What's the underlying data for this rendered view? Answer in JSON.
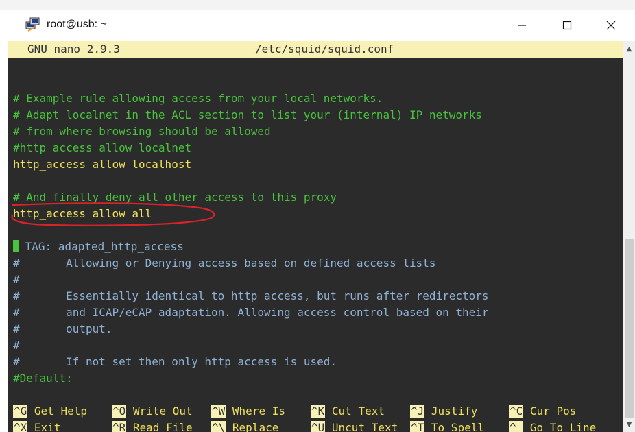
{
  "window": {
    "title": "root@usb: ~",
    "app_icon": "putty-icon",
    "controls": {
      "minimize": "minimize-icon",
      "maximize": "maximize-icon",
      "close": "close-icon"
    }
  },
  "editor": {
    "version": "GNU nano 2.9.3",
    "filename": "/etc/squid/squid.conf",
    "lines": [
      {
        "text": ""
      },
      {
        "text": ""
      },
      {
        "text": "# Example rule allowing access from your local networks.",
        "type": "comment"
      },
      {
        "text": "# Adapt localnet in the ACL section to list your (internal) IP networks",
        "type": "comment"
      },
      {
        "text": "# from where browsing should be allowed",
        "type": "comment"
      },
      {
        "text": "#http_access allow localnet",
        "type": "comment"
      },
      {
        "text": "http_access allow localhost",
        "type": "directive"
      },
      {
        "text": ""
      },
      {
        "text": "# And finally deny all other access to this proxy",
        "type": "comment"
      },
      {
        "text": "http_access allow all",
        "type": "directive"
      },
      {
        "text": ""
      },
      {
        "text": " TAG: adapted_http_access",
        "type": "tag",
        "prefix": "#"
      },
      {
        "text": "#       Allowing or Denying access based on defined access lists",
        "type": "doc"
      },
      {
        "text": "#",
        "type": "doc"
      },
      {
        "text": "#       Essentially identical to http_access, but runs after redirectors",
        "type": "doc"
      },
      {
        "text": "#       and ICAP/eCAP adaptation. Allowing access control based on their",
        "type": "doc"
      },
      {
        "text": "#       output.",
        "type": "doc"
      },
      {
        "text": "#",
        "type": "doc"
      },
      {
        "text": "#       If not set then only http_access is used.",
        "type": "doc"
      },
      {
        "text": "#Default:",
        "type": "comment"
      }
    ],
    "shortcuts_row1": [
      {
        "key": "^G",
        "label": "Get Help"
      },
      {
        "key": "^O",
        "label": "Write Out"
      },
      {
        "key": "^W",
        "label": "Where Is"
      },
      {
        "key": "^K",
        "label": "Cut Text"
      },
      {
        "key": "^J",
        "label": "Justify"
      },
      {
        "key": "^C",
        "label": "Cur Pos"
      }
    ],
    "shortcuts_row2": [
      {
        "key": "^X",
        "label": "Exit"
      },
      {
        "key": "^R",
        "label": "Read File"
      },
      {
        "key": "^\\",
        "label": "Replace"
      },
      {
        "key": "^U",
        "label": "Uncut Text"
      },
      {
        "key": "^T",
        "label": "To Spell"
      },
      {
        "key": "^_",
        "label": "Go To Line"
      }
    ]
  },
  "colors": {
    "terminal_bg": "#2b2b2b",
    "comment": "#49c23d",
    "directive": "#efe05a",
    "doc": "#8fb0d4",
    "header_bg": "#f7f1b5",
    "annotation": "#d8232a"
  }
}
